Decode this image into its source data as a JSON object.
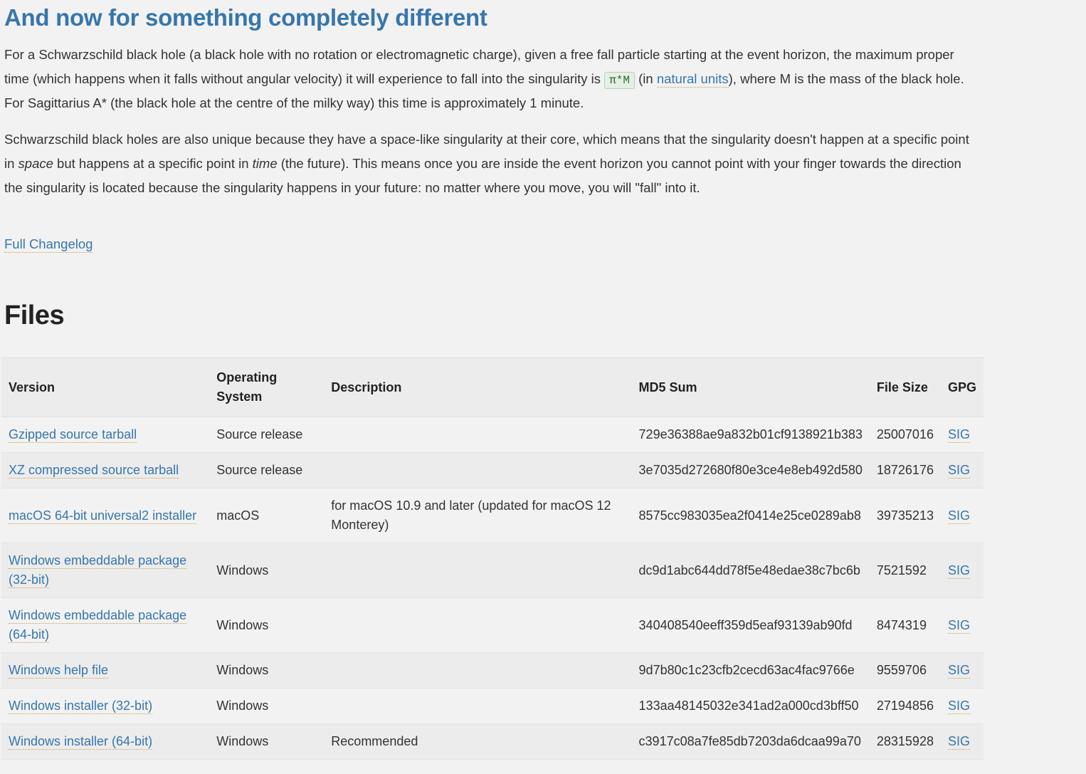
{
  "section_heading": "And now for something completely different",
  "paragraph1": {
    "pre_code": "For a Schwarzschild black hole (a black hole with no rotation or electromagnetic charge), given a free fall particle starting at the event horizon, the maximum proper time (which hap­pens when it falls without angular velocity) it will experience to fall into the singularity is ",
    "code": "π*M",
    "post_code_pre_link": " (in ",
    "link_text": "natural units",
    "post_link": "), where M is the mass of the black hole. For Sagittarius A* (the black hole at the centre of the milky way) this time is approximately 1 minute."
  },
  "paragraph2": {
    "t1": "Schwarzschild black holes are also unique because they have a space-like singularity at their core, which means that the singularity doesn't happen at a specific point in ",
    "em1": "space",
    "t2": " but hap­pens at a specific point in ",
    "em2": "time",
    "t3": " (the future). This means once you are inside the event horizon you cannot point with your finger towards the direction the singularity is located because the singularity happens in your future: no matter where you move, you will \"fall\" into it."
  },
  "full_changelog": "Full Changelog",
  "files_heading": "Files",
  "table": {
    "headers": {
      "version": "Version",
      "os": "Operating System",
      "description": "Description",
      "md5": "MD5 Sum",
      "size": "File Size",
      "gpg": "GPG"
    },
    "sig_label": "SIG",
    "rows": [
      {
        "version": "Gzipped source tarball",
        "os": "Source release",
        "description": "",
        "md5": "729e36388ae9a832b01cf9138921b383",
        "size": "25007016"
      },
      {
        "version": "XZ compressed source tarball",
        "os": "Source release",
        "description": "",
        "md5": "3e7035d272680f80e3ce4e8eb492d580",
        "size": "18726176"
      },
      {
        "version": "macOS 64-bit universal2 installer",
        "os": "macOS",
        "description": "for macOS 10.9 and later (updated for macOS 12 Monterey)",
        "md5": "8575cc983035ea2f0414e25ce0289ab8",
        "size": "39735213"
      },
      {
        "version": "Windows embeddable package (32-bit)",
        "os": "Windows",
        "description": "",
        "md5": "dc9d1abc644dd78f5e48edae38c7bc6b",
        "size": "7521592"
      },
      {
        "version": "Windows embeddable package (64-bit)",
        "os": "Windows",
        "description": "",
        "md5": "340408540eeff359d5eaf93139ab90fd",
        "size": "8474319"
      },
      {
        "version": "Windows help file",
        "os": "Windows",
        "description": "",
        "md5": "9d7b80c1c23cfb2cecd63ac4fac9766e",
        "size": "9559706"
      },
      {
        "version": "Windows installer (32-bit)",
        "os": "Windows",
        "description": "",
        "md5": "133aa48145032e341ad2a000cd3bff50",
        "size": "27194856"
      },
      {
        "version": "Windows installer (64-bit)",
        "os": "Windows",
        "description": "Recommended",
        "md5": "c3917c08a7fe85db7203da6dcaa99a70",
        "size": "28315928"
      }
    ]
  }
}
